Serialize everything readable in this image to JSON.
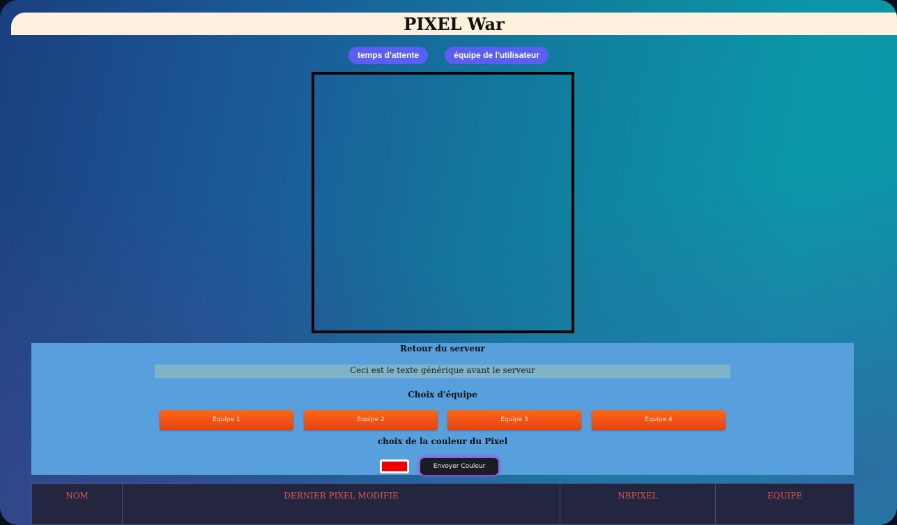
{
  "header": {
    "title": "PIXEL War"
  },
  "top_buttons": {
    "wait_time": "temps d'attente",
    "user_team": "équipe de l'utilisateur"
  },
  "server": {
    "heading": "Retour du serveur",
    "message": "Ceci est le texte générique avant le serveur"
  },
  "teams": {
    "heading": "Choix d'équipe",
    "buttons": [
      "Equipe 1",
      "Equipe 2",
      "Equipe 3",
      "Equipe 4"
    ]
  },
  "color": {
    "heading": "choix de la couleur du Pixel",
    "value": "#ee0000",
    "send_label": "Envoyer Couleur"
  },
  "table": {
    "columns": [
      "NOM",
      "DERNIER PIXEL MODIFIE",
      "NBPIXEL",
      "EQUIPE"
    ]
  },
  "colors": {
    "title_bar": "#fdf0dc",
    "pill": "#5b5ef0",
    "panel": "#58a0dd",
    "team_button": "#f25a18",
    "table_header_text": "#e0565a"
  }
}
